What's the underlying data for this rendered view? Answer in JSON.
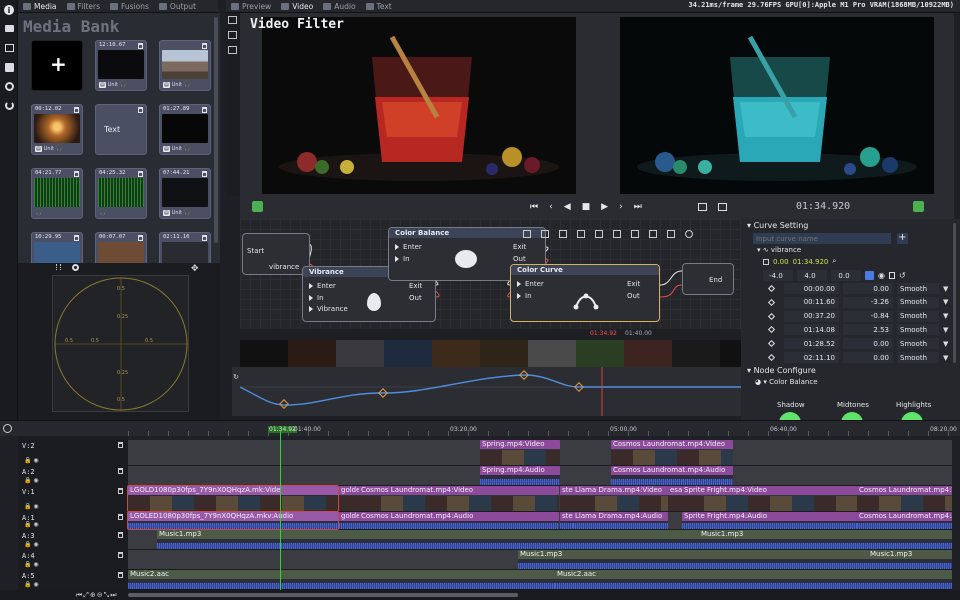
{
  "top_tabs": {
    "left": [
      {
        "label": "Media"
      },
      {
        "label": "Filters"
      },
      {
        "label": "Fusions"
      },
      {
        "label": "Output"
      }
    ],
    "center": [
      {
        "label": "Preview"
      },
      {
        "label": "Video"
      },
      {
        "label": "Audio"
      },
      {
        "label": "Text"
      }
    ]
  },
  "status": "34.21ms/frame 29.76FPS GPU[0]:Apple M1 Pro VRAM(1868MB/10922MB)",
  "media_bank": {
    "title": "Media Bank",
    "add_icon": "plus-icon",
    "text_card_label": "Text",
    "cards": [
      {
        "dur": "",
        "type": "add"
      },
      {
        "dur": "12:10.67",
        "badge": "Unit",
        "thumb": "#0b0b0d"
      },
      {
        "dur": "",
        "badge": "Unit",
        "thumb": "mountain"
      },
      {
        "dur": "00:12.02",
        "badge": "Unit",
        "thumb": "sunset"
      },
      {
        "dur": "",
        "type": "text"
      },
      {
        "dur": "01:27.89",
        "badge": "Unit",
        "thumb": "#070708"
      },
      {
        "dur": "04:21.77",
        "badge": "",
        "thumb": "wave"
      },
      {
        "dur": "04:25.32",
        "badge": "",
        "thumb": "wave"
      },
      {
        "dur": "07:44.21",
        "badge": "Unit",
        "thumb": "#101114"
      },
      {
        "dur": "10:29.95",
        "badge": "",
        "thumb": "#3b5d8a"
      },
      {
        "dur": "00:07.07",
        "badge": "",
        "thumb": "#6d4b34"
      },
      {
        "dur": "02:11.10",
        "badge": "",
        "thumb": "#2a2b30"
      }
    ]
  },
  "scope": {
    "labels": [
      "0.5",
      "0.5",
      "0.5",
      "0.5",
      "0.25",
      "0.25",
      "0.5"
    ]
  },
  "preview": {
    "title": "Video Filter",
    "timecode": "01:34.920"
  },
  "transport": {
    "icons": [
      "skip-start-icon",
      "prev-frame-icon",
      "play-back-icon",
      "stop-icon",
      "play-icon",
      "next-frame-icon",
      "skip-end-icon"
    ]
  },
  "graph": {
    "nodes": {
      "start": {
        "title": "Start",
        "out": "vibrance"
      },
      "vibrance": {
        "title": "Vibrance",
        "rows": [
          "Enter",
          "In",
          "Vibrance"
        ],
        "outs": [
          "Exit",
          "Out"
        ]
      },
      "balance": {
        "title": "Color Balance",
        "rows": [
          "Enter",
          "In"
        ],
        "outs": [
          "Exit",
          "Out"
        ]
      },
      "curve": {
        "title": "Color Curve",
        "rows": [
          "Enter",
          "In"
        ],
        "outs": [
          "Exit",
          "Out"
        ]
      },
      "end": {
        "title": "End"
      }
    },
    "ruler_time": "01:34.92",
    "ruler_next": "01:40.00"
  },
  "curve_setting": {
    "title": "Curve Setting",
    "placeholder": "Input curve name",
    "tree_label": "vibrance",
    "cursor_value": "0.00",
    "cursor_time": "01:34.920",
    "range": [
      "-4.0",
      "4.0",
      "0.0"
    ],
    "points": [
      {
        "t": "00:00.00",
        "v": "0.00",
        "mode": "Smooth"
      },
      {
        "t": "00:11.60",
        "v": "-3.26",
        "mode": "Smooth"
      },
      {
        "t": "00:37.20",
        "v": "-0.84",
        "mode": "Smooth"
      },
      {
        "t": "01:14.08",
        "v": "2.53",
        "mode": "Smooth"
      },
      {
        "t": "01:28.52",
        "v": "0.00",
        "mode": "Smooth"
      },
      {
        "t": "02:11.10",
        "v": "0.00",
        "mode": "Smooth"
      }
    ],
    "node_configure": "Node Configure",
    "node_name": "Color Balance",
    "wheels": [
      "Shadow",
      "Midtones",
      "Highlights"
    ]
  },
  "timeline": {
    "ruler": [
      {
        "t": "01:34.92"
      },
      {
        "t": "01:40.00"
      },
      {
        "t": "03:20.00"
      },
      {
        "t": "05:00.00"
      },
      {
        "t": "06:40.00"
      },
      {
        "t": "08:20.00"
      }
    ],
    "tracks": [
      "V:2",
      "A:2",
      "V:1",
      "A:1",
      "A:3",
      "A:4",
      "A:5"
    ],
    "clips": [
      {
        "label": "Spring.mp4:Video"
      },
      {
        "label": "Cosmos Laundromat.mp4:Video"
      },
      {
        "label": "Spring.mp4:Audio"
      },
      {
        "label": "Cosmos Laundromat.mp4:Audio"
      },
      {
        "label": "LGOLD1080p30fps_7Y9nX0QHqzA.mk:Vide"
      },
      {
        "label": "golde"
      },
      {
        "label": "Cosmos Laundromat.mp4:Video"
      },
      {
        "label": "ste"
      },
      {
        "label": "Llama Drama.mp4:Video"
      },
      {
        "label": "esa"
      },
      {
        "label": "Sprite Fright.mp4:Video"
      },
      {
        "label": "Cosmos Laundromat.mp4:Vi"
      },
      {
        "label": "LGOLED1080p30fps_7Y9nX0QHqzA.mkv:Audio"
      },
      {
        "label": "golde"
      },
      {
        "label": "Cosmos Laundromat.mp4:Audio"
      },
      {
        "label": "ste"
      },
      {
        "label": "Llama Drama.mp4:Audio"
      },
      {
        "label": "Sprite Fright.mp4:Audio"
      },
      {
        "label": "Cosmos Laundromat.mp4:Au"
      },
      {
        "label": "Music1.mp3"
      },
      {
        "label": "Music1.mp3"
      },
      {
        "label": "Music1.mp3"
      },
      {
        "label": "Music1.mp3"
      },
      {
        "label": "Music2.aac"
      },
      {
        "label": "Music2.aac"
      }
    ]
  }
}
